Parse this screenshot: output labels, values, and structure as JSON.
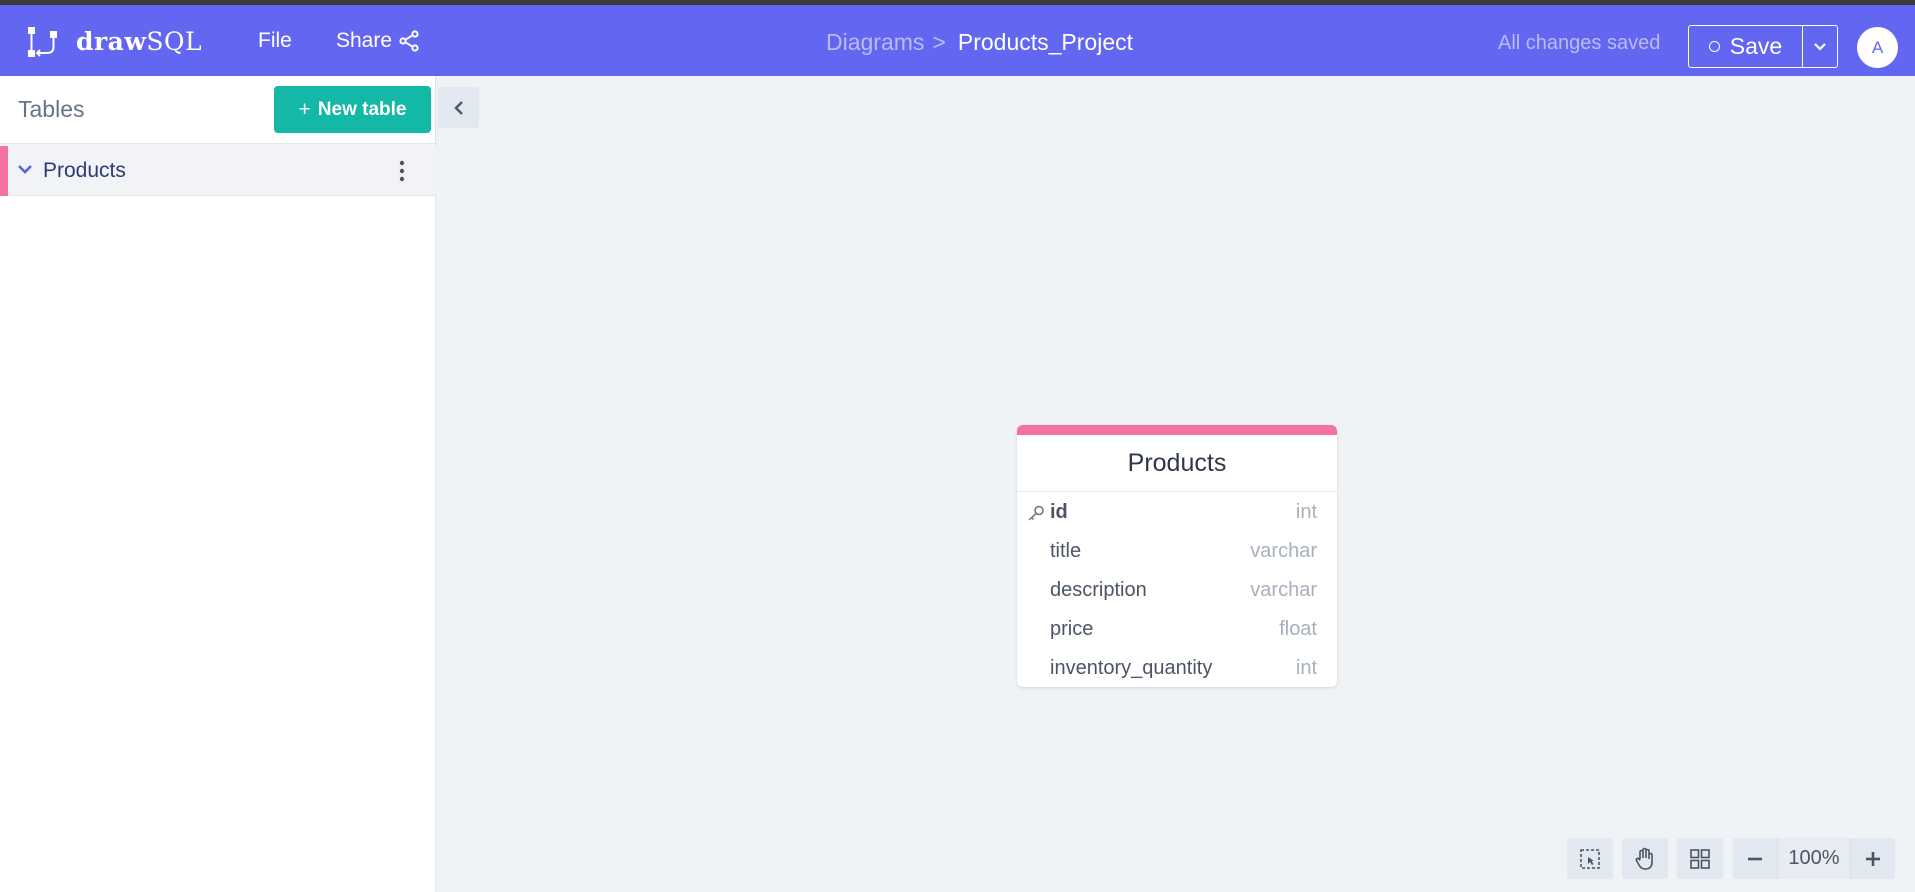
{
  "app": {
    "logo_bold": "draw",
    "logo_light": "SQL"
  },
  "nav": {
    "file_label": "File",
    "share_label": "Share"
  },
  "breadcrumb": {
    "parent": "Diagrams",
    "separator": ">",
    "current": "Products_Project"
  },
  "status": {
    "saved_text": "All changes saved"
  },
  "save": {
    "label": "Save"
  },
  "user": {
    "avatar_initial": "A"
  },
  "sidebar": {
    "title": "Tables",
    "new_table_label": "New table",
    "tables": [
      {
        "name": "Products",
        "color": "#f472a0"
      }
    ]
  },
  "canvas": {
    "table": {
      "name": "Products",
      "color": "#f472a0",
      "columns": [
        {
          "name": "id",
          "type": "int",
          "primary_key": true
        },
        {
          "name": "title",
          "type": "varchar"
        },
        {
          "name": "description",
          "type": "varchar"
        },
        {
          "name": "price",
          "type": "float"
        },
        {
          "name": "inventory_quantity",
          "type": "int"
        }
      ]
    }
  },
  "zoom": {
    "level": "100%"
  },
  "colors": {
    "navbar": "#6366f1",
    "accent_teal": "#14b8a6",
    "table_pink": "#f472a0",
    "canvas_bg": "#eff3f6"
  },
  "icons": [
    "drawsql-logo-icon",
    "share-icon",
    "chevron-down-icon",
    "kebab-menu-icon",
    "chevron-left-icon",
    "key-icon",
    "select-area-icon",
    "hand-icon",
    "grid-icon",
    "minus-icon",
    "plus-icon"
  ]
}
